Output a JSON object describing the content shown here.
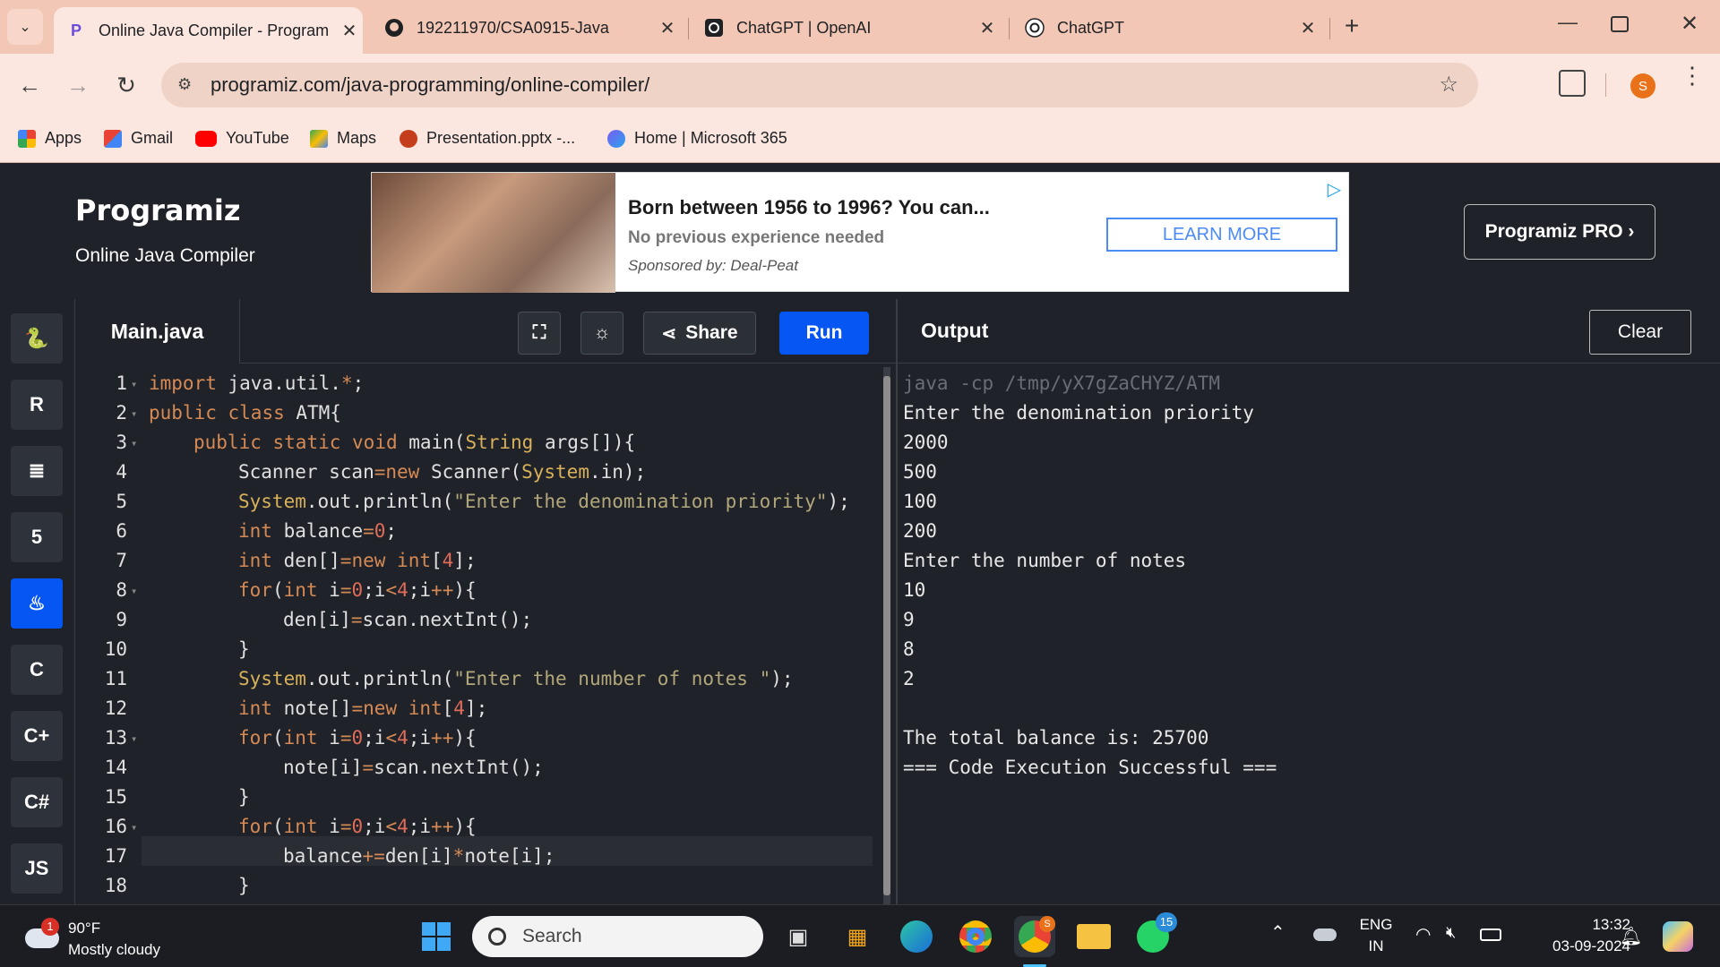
{
  "browser": {
    "tabs": [
      {
        "title": "Online Java Compiler - Program",
        "active": true,
        "icon": "programiz-icon"
      },
      {
        "title": "192211970/CSA0915-Java",
        "active": false,
        "icon": "github-icon"
      },
      {
        "title": "ChatGPT | OpenAI",
        "active": false,
        "icon": "openai-icon"
      },
      {
        "title": "ChatGPT",
        "active": false,
        "icon": "openai-icon"
      }
    ],
    "url": "programiz.com/java-programming/online-compiler/",
    "profile_initial": "S",
    "bookmarks": [
      {
        "label": "Apps",
        "icon": "apps-grid-icon"
      },
      {
        "label": "Gmail",
        "icon": "gmail-icon"
      },
      {
        "label": "YouTube",
        "icon": "youtube-icon"
      },
      {
        "label": "Maps",
        "icon": "maps-icon"
      },
      {
        "label": "Presentation.pptx -...",
        "icon": "powerpoint-icon"
      },
      {
        "label": "Home | Microsoft 365",
        "icon": "m365-icon"
      }
    ]
  },
  "header": {
    "logo": "Programiz",
    "subtitle": "Online Java Compiler",
    "pro_button": "Programiz PRO ›"
  },
  "ad": {
    "headline": "Born between 1956 to 1996? You can...",
    "subline": "No previous experience needed",
    "sponsor": "Sponsored by: Deal-Peat",
    "cta": "LEARN MORE"
  },
  "editor": {
    "filename": "Main.java",
    "share_label": "Share",
    "run_label": "Run",
    "lines": [
      {
        "n": "1",
        "fold": true,
        "indent": 0,
        "parts": [
          [
            "kw",
            "import"
          ],
          [
            "t",
            " java.util."
          ],
          [
            "op",
            "*"
          ],
          [
            "t",
            ";"
          ]
        ]
      },
      {
        "n": "2",
        "fold": true,
        "indent": 0,
        "parts": [
          [
            "kw",
            "public"
          ],
          [
            "t",
            " "
          ],
          [
            "kw",
            "class"
          ],
          [
            "t",
            " ATM{"
          ]
        ]
      },
      {
        "n": "3",
        "fold": true,
        "indent": 1,
        "parts": [
          [
            "kw",
            "public"
          ],
          [
            "t",
            " "
          ],
          [
            "kw",
            "static"
          ],
          [
            "t",
            " "
          ],
          [
            "kw",
            "void"
          ],
          [
            "t",
            " main("
          ],
          [
            "cls",
            "String"
          ],
          [
            "t",
            " args[]){"
          ]
        ]
      },
      {
        "n": "4",
        "fold": false,
        "indent": 2,
        "parts": [
          [
            "t",
            "Scanner scan"
          ],
          [
            "op",
            "="
          ],
          [
            "kw",
            "new"
          ],
          [
            "t",
            " Scanner("
          ],
          [
            "cls",
            "System"
          ],
          [
            "t",
            ".in);"
          ]
        ]
      },
      {
        "n": "5",
        "fold": false,
        "indent": 2,
        "parts": [
          [
            "cls",
            "System"
          ],
          [
            "t",
            ".out.println("
          ],
          [
            "str",
            "\"Enter the denomination priority\""
          ],
          [
            "t",
            ");"
          ]
        ]
      },
      {
        "n": "6",
        "fold": false,
        "indent": 2,
        "parts": [
          [
            "kw",
            "int"
          ],
          [
            "t",
            " balance"
          ],
          [
            "op",
            "="
          ],
          [
            "num",
            "0"
          ],
          [
            "t",
            ";"
          ]
        ]
      },
      {
        "n": "7",
        "fold": false,
        "indent": 2,
        "parts": [
          [
            "kw",
            "int"
          ],
          [
            "t",
            " den[]"
          ],
          [
            "op",
            "="
          ],
          [
            "kw",
            "new"
          ],
          [
            "t",
            " "
          ],
          [
            "kw",
            "int"
          ],
          [
            "t",
            "["
          ],
          [
            "num",
            "4"
          ],
          [
            "t",
            "];"
          ]
        ]
      },
      {
        "n": "8",
        "fold": true,
        "indent": 2,
        "parts": [
          [
            "kw",
            "for"
          ],
          [
            "t",
            "("
          ],
          [
            "kw",
            "int"
          ],
          [
            "t",
            " i"
          ],
          [
            "op",
            "="
          ],
          [
            "num",
            "0"
          ],
          [
            "t",
            ";i"
          ],
          [
            "op",
            "<"
          ],
          [
            "num",
            "4"
          ],
          [
            "t",
            ";i"
          ],
          [
            "op",
            "++"
          ],
          [
            "t",
            "){"
          ]
        ]
      },
      {
        "n": "9",
        "fold": false,
        "indent": 3,
        "parts": [
          [
            "t",
            "den[i]"
          ],
          [
            "op",
            "="
          ],
          [
            "t",
            "scan.nextInt();"
          ]
        ]
      },
      {
        "n": "10",
        "fold": false,
        "indent": 2,
        "parts": [
          [
            "t",
            "}"
          ]
        ]
      },
      {
        "n": "11",
        "fold": false,
        "indent": 2,
        "parts": [
          [
            "cls",
            "System"
          ],
          [
            "t",
            ".out.println("
          ],
          [
            "str",
            "\"Enter the number of notes \""
          ],
          [
            "t",
            ");"
          ]
        ]
      },
      {
        "n": "12",
        "fold": false,
        "indent": 2,
        "parts": [
          [
            "kw",
            "int"
          ],
          [
            "t",
            " note[]"
          ],
          [
            "op",
            "="
          ],
          [
            "kw",
            "new"
          ],
          [
            "t",
            " "
          ],
          [
            "kw",
            "int"
          ],
          [
            "t",
            "["
          ],
          [
            "num",
            "4"
          ],
          [
            "t",
            "];"
          ]
        ]
      },
      {
        "n": "13",
        "fold": true,
        "indent": 2,
        "parts": [
          [
            "kw",
            "for"
          ],
          [
            "t",
            "("
          ],
          [
            "kw",
            "int"
          ],
          [
            "t",
            " i"
          ],
          [
            "op",
            "="
          ],
          [
            "num",
            "0"
          ],
          [
            "t",
            ";i"
          ],
          [
            "op",
            "<"
          ],
          [
            "num",
            "4"
          ],
          [
            "t",
            ";i"
          ],
          [
            "op",
            "++"
          ],
          [
            "t",
            "){"
          ]
        ]
      },
      {
        "n": "14",
        "fold": false,
        "indent": 3,
        "parts": [
          [
            "t",
            "note[i]"
          ],
          [
            "op",
            "="
          ],
          [
            "t",
            "scan.nextInt();"
          ]
        ]
      },
      {
        "n": "15",
        "fold": false,
        "indent": 2,
        "parts": [
          [
            "t",
            "}"
          ]
        ]
      },
      {
        "n": "16",
        "fold": true,
        "indent": 2,
        "parts": [
          [
            "kw",
            "for"
          ],
          [
            "t",
            "("
          ],
          [
            "kw",
            "int"
          ],
          [
            "t",
            " i"
          ],
          [
            "op",
            "="
          ],
          [
            "num",
            "0"
          ],
          [
            "t",
            ";i"
          ],
          [
            "op",
            "<"
          ],
          [
            "num",
            "4"
          ],
          [
            "t",
            ";i"
          ],
          [
            "op",
            "++"
          ],
          [
            "t",
            "){"
          ]
        ]
      },
      {
        "n": "17",
        "fold": false,
        "indent": 3,
        "parts": [
          [
            "t",
            "balance"
          ],
          [
            "op",
            "+="
          ],
          [
            "t",
            "den[i]"
          ],
          [
            "op",
            "*"
          ],
          [
            "t",
            "note[i];"
          ]
        ]
      },
      {
        "n": "18",
        "fold": false,
        "indent": 2,
        "parts": [
          [
            "t",
            "}"
          ]
        ]
      }
    ]
  },
  "sidebar_langs": [
    {
      "name": "python-icon",
      "glyph": "🐍",
      "active": false
    },
    {
      "name": "r-icon",
      "glyph": "R",
      "active": false
    },
    {
      "name": "sql-icon",
      "glyph": "≣",
      "active": false
    },
    {
      "name": "html5-icon",
      "glyph": "5",
      "active": false
    },
    {
      "name": "java-icon",
      "glyph": "♨",
      "active": true
    },
    {
      "name": "c-icon",
      "glyph": "C",
      "active": false
    },
    {
      "name": "cpp-icon",
      "glyph": "C+",
      "active": false
    },
    {
      "name": "csharp-icon",
      "glyph": "C#",
      "active": false
    },
    {
      "name": "javascript-icon",
      "glyph": "JS",
      "active": false
    }
  ],
  "output": {
    "title": "Output",
    "clear_label": "Clear",
    "lines": [
      {
        "text": "java -cp /tmp/yX7gZaCHYZ/ATM",
        "dim": true
      },
      {
        "text": "Enter the denomination priority",
        "dim": false
      },
      {
        "text": "2000",
        "dim": false
      },
      {
        "text": "500",
        "dim": false
      },
      {
        "text": "100",
        "dim": false
      },
      {
        "text": "200",
        "dim": false
      },
      {
        "text": "Enter the number of notes",
        "dim": false
      },
      {
        "text": "10",
        "dim": false
      },
      {
        "text": "9",
        "dim": false
      },
      {
        "text": "8",
        "dim": false
      },
      {
        "text": "2",
        "dim": false
      },
      {
        "text": "",
        "dim": false
      },
      {
        "text": "The total balance is: 25700",
        "dim": false
      },
      {
        "text": "=== Code Execution Successful ===",
        "dim": false
      }
    ]
  },
  "taskbar": {
    "weather_temp": "90°F",
    "weather_desc": "Mostly cloudy",
    "weather_badge": "1",
    "search_placeholder": "Search",
    "whatsapp_badge": "15",
    "chrome_badge": "S",
    "lang_top": "ENG",
    "lang_bottom": "IN",
    "time": "13:32",
    "date": "03-09-2024"
  }
}
